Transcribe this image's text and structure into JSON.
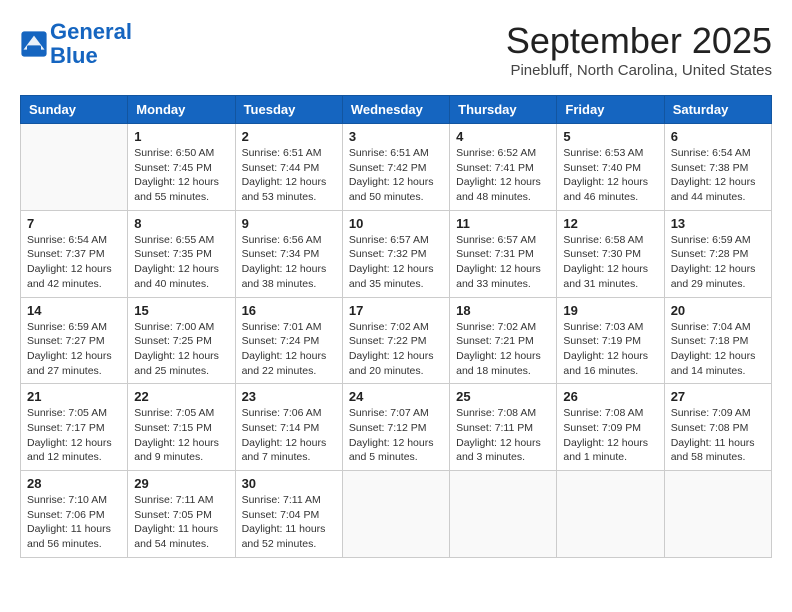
{
  "logo": {
    "line1": "General",
    "line2": "Blue"
  },
  "title": "September 2025",
  "location": "Pinebluff, North Carolina, United States",
  "weekdays": [
    "Sunday",
    "Monday",
    "Tuesday",
    "Wednesday",
    "Thursday",
    "Friday",
    "Saturday"
  ],
  "weeks": [
    [
      {
        "day": "",
        "info": ""
      },
      {
        "day": "1",
        "info": "Sunrise: 6:50 AM\nSunset: 7:45 PM\nDaylight: 12 hours\nand 55 minutes."
      },
      {
        "day": "2",
        "info": "Sunrise: 6:51 AM\nSunset: 7:44 PM\nDaylight: 12 hours\nand 53 minutes."
      },
      {
        "day": "3",
        "info": "Sunrise: 6:51 AM\nSunset: 7:42 PM\nDaylight: 12 hours\nand 50 minutes."
      },
      {
        "day": "4",
        "info": "Sunrise: 6:52 AM\nSunset: 7:41 PM\nDaylight: 12 hours\nand 48 minutes."
      },
      {
        "day": "5",
        "info": "Sunrise: 6:53 AM\nSunset: 7:40 PM\nDaylight: 12 hours\nand 46 minutes."
      },
      {
        "day": "6",
        "info": "Sunrise: 6:54 AM\nSunset: 7:38 PM\nDaylight: 12 hours\nand 44 minutes."
      }
    ],
    [
      {
        "day": "7",
        "info": "Sunrise: 6:54 AM\nSunset: 7:37 PM\nDaylight: 12 hours\nand 42 minutes."
      },
      {
        "day": "8",
        "info": "Sunrise: 6:55 AM\nSunset: 7:35 PM\nDaylight: 12 hours\nand 40 minutes."
      },
      {
        "day": "9",
        "info": "Sunrise: 6:56 AM\nSunset: 7:34 PM\nDaylight: 12 hours\nand 38 minutes."
      },
      {
        "day": "10",
        "info": "Sunrise: 6:57 AM\nSunset: 7:32 PM\nDaylight: 12 hours\nand 35 minutes."
      },
      {
        "day": "11",
        "info": "Sunrise: 6:57 AM\nSunset: 7:31 PM\nDaylight: 12 hours\nand 33 minutes."
      },
      {
        "day": "12",
        "info": "Sunrise: 6:58 AM\nSunset: 7:30 PM\nDaylight: 12 hours\nand 31 minutes."
      },
      {
        "day": "13",
        "info": "Sunrise: 6:59 AM\nSunset: 7:28 PM\nDaylight: 12 hours\nand 29 minutes."
      }
    ],
    [
      {
        "day": "14",
        "info": "Sunrise: 6:59 AM\nSunset: 7:27 PM\nDaylight: 12 hours\nand 27 minutes."
      },
      {
        "day": "15",
        "info": "Sunrise: 7:00 AM\nSunset: 7:25 PM\nDaylight: 12 hours\nand 25 minutes."
      },
      {
        "day": "16",
        "info": "Sunrise: 7:01 AM\nSunset: 7:24 PM\nDaylight: 12 hours\nand 22 minutes."
      },
      {
        "day": "17",
        "info": "Sunrise: 7:02 AM\nSunset: 7:22 PM\nDaylight: 12 hours\nand 20 minutes."
      },
      {
        "day": "18",
        "info": "Sunrise: 7:02 AM\nSunset: 7:21 PM\nDaylight: 12 hours\nand 18 minutes."
      },
      {
        "day": "19",
        "info": "Sunrise: 7:03 AM\nSunset: 7:19 PM\nDaylight: 12 hours\nand 16 minutes."
      },
      {
        "day": "20",
        "info": "Sunrise: 7:04 AM\nSunset: 7:18 PM\nDaylight: 12 hours\nand 14 minutes."
      }
    ],
    [
      {
        "day": "21",
        "info": "Sunrise: 7:05 AM\nSunset: 7:17 PM\nDaylight: 12 hours\nand 12 minutes."
      },
      {
        "day": "22",
        "info": "Sunrise: 7:05 AM\nSunset: 7:15 PM\nDaylight: 12 hours\nand 9 minutes."
      },
      {
        "day": "23",
        "info": "Sunrise: 7:06 AM\nSunset: 7:14 PM\nDaylight: 12 hours\nand 7 minutes."
      },
      {
        "day": "24",
        "info": "Sunrise: 7:07 AM\nSunset: 7:12 PM\nDaylight: 12 hours\nand 5 minutes."
      },
      {
        "day": "25",
        "info": "Sunrise: 7:08 AM\nSunset: 7:11 PM\nDaylight: 12 hours\nand 3 minutes."
      },
      {
        "day": "26",
        "info": "Sunrise: 7:08 AM\nSunset: 7:09 PM\nDaylight: 12 hours\nand 1 minute."
      },
      {
        "day": "27",
        "info": "Sunrise: 7:09 AM\nSunset: 7:08 PM\nDaylight: 11 hours\nand 58 minutes."
      }
    ],
    [
      {
        "day": "28",
        "info": "Sunrise: 7:10 AM\nSunset: 7:06 PM\nDaylight: 11 hours\nand 56 minutes."
      },
      {
        "day": "29",
        "info": "Sunrise: 7:11 AM\nSunset: 7:05 PM\nDaylight: 11 hours\nand 54 minutes."
      },
      {
        "day": "30",
        "info": "Sunrise: 7:11 AM\nSunset: 7:04 PM\nDaylight: 11 hours\nand 52 minutes."
      },
      {
        "day": "",
        "info": ""
      },
      {
        "day": "",
        "info": ""
      },
      {
        "day": "",
        "info": ""
      },
      {
        "day": "",
        "info": ""
      }
    ]
  ]
}
